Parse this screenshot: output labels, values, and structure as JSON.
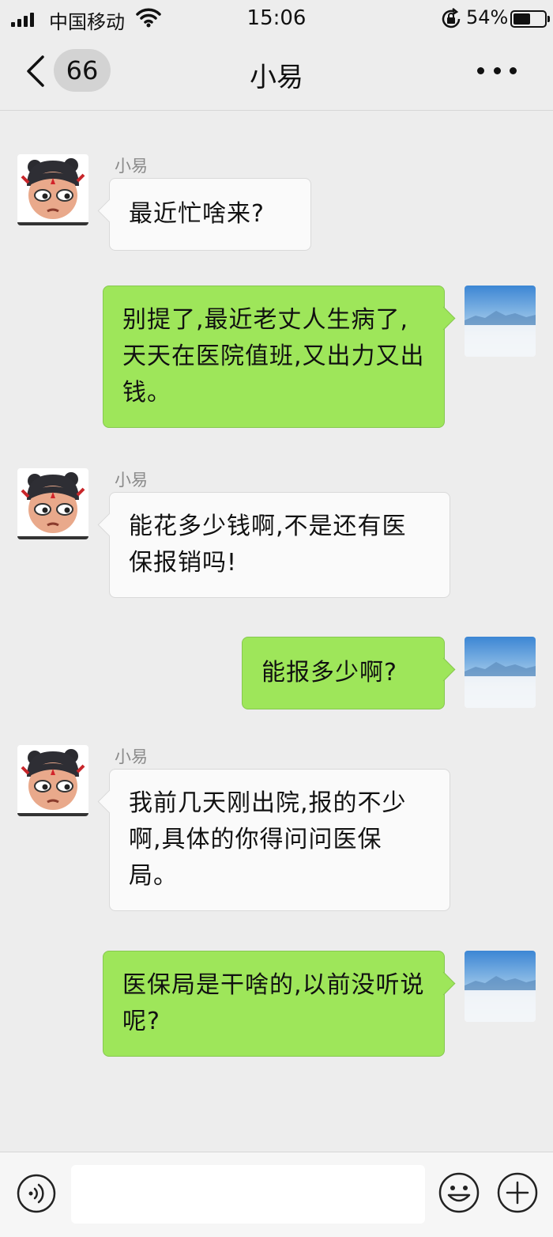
{
  "status_bar": {
    "carrier": "中国移动",
    "time": "15:06",
    "battery_percent": "54%",
    "battery_level": 0.54
  },
  "nav": {
    "back_icon": "chevron-left-icon",
    "unread_count": "66",
    "title": "小易",
    "more_icon": "more-dots-icon"
  },
  "messages": [
    {
      "direction": "in",
      "sender": "小易",
      "text": "最近忙啥来?"
    },
    {
      "direction": "out",
      "text": "别提了,最近老丈人生病了,天天在医院值班,又出力又出钱。"
    },
    {
      "direction": "in",
      "sender": "小易",
      "text": "能花多少钱啊,不是还有医保报销吗!"
    },
    {
      "direction": "out",
      "text": "能报多少啊?"
    },
    {
      "direction": "in",
      "sender": "小易",
      "text": "我前几天刚出院,报的不少啊,具体的你得问问医保局。"
    },
    {
      "direction": "out",
      "text": "医保局是干啥的,以前没听说呢?"
    }
  ],
  "input_bar": {
    "voice_icon": "voice-icon",
    "emoji_icon": "emoji-icon",
    "plus_icon": "plus-icon",
    "input_value": ""
  },
  "colors": {
    "background": "#ededed",
    "outgoing_bubble": "#9ee65a",
    "incoming_bubble": "#fafafa"
  }
}
